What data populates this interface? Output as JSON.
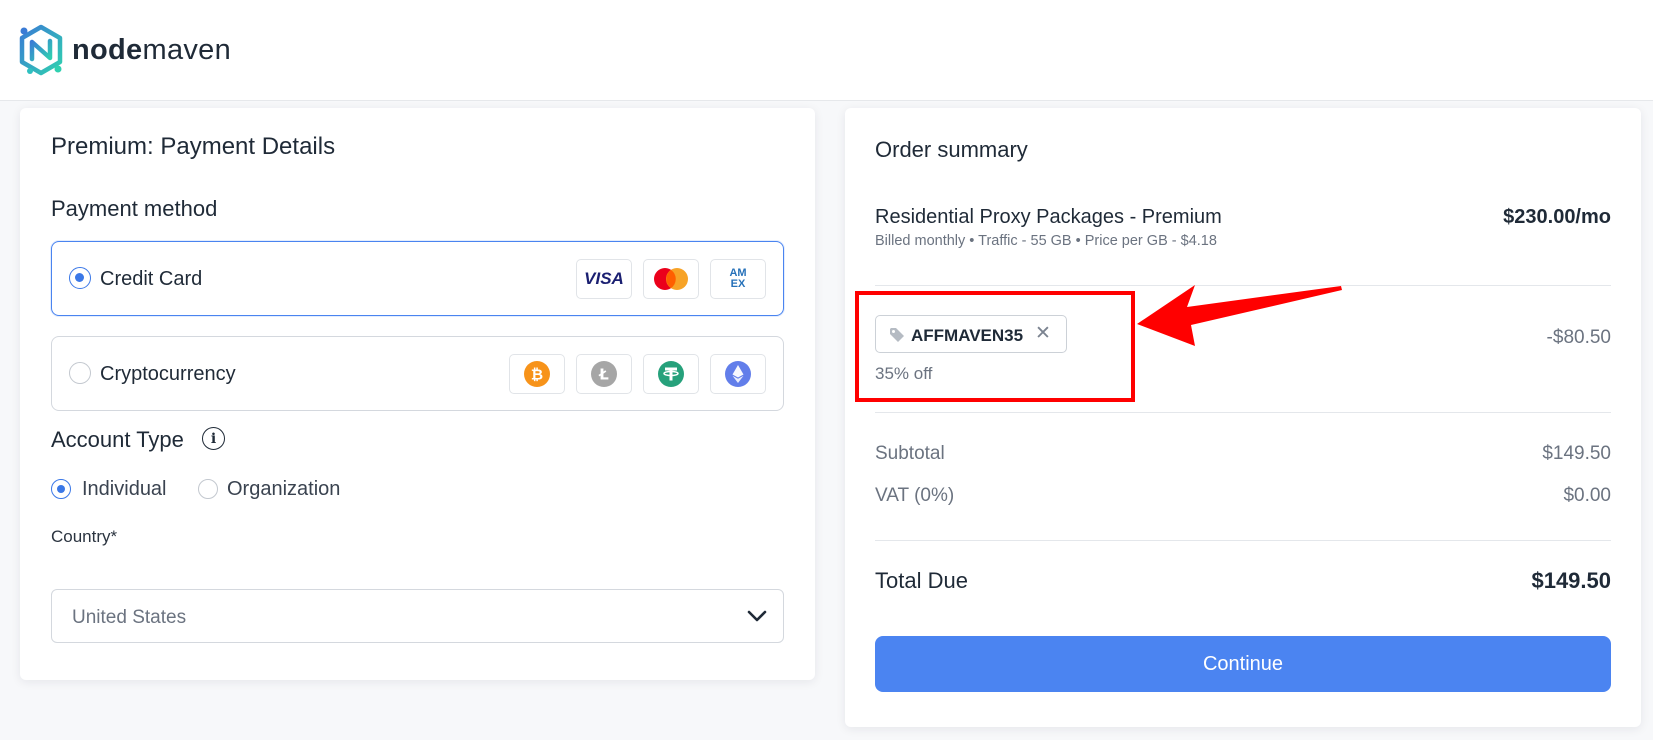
{
  "brand": {
    "name_bold": "node",
    "name_light": "maven"
  },
  "payment": {
    "title": "Premium: Payment Details",
    "method_heading": "Payment method",
    "options": [
      {
        "label": "Credit Card",
        "selected": true,
        "brands": [
          "visa-icon",
          "mastercard-icon",
          "amex-icon"
        ]
      },
      {
        "label": "Cryptocurrency",
        "selected": false,
        "brands": [
          "bitcoin-icon",
          "litecoin-icon",
          "tether-icon",
          "ethereum-icon"
        ]
      }
    ],
    "visa_text": "VISA",
    "amex_text": "AM EX",
    "account_heading": "Account Type",
    "info_glyph": "i",
    "account_options": [
      {
        "label": "Individual",
        "selected": true
      },
      {
        "label": "Organization",
        "selected": false
      }
    ],
    "country_label": "Country*",
    "country_value": "United States"
  },
  "summary": {
    "title": "Order summary",
    "item_title": "Residential Proxy Packages - Premium",
    "item_price": "$230.00/mo",
    "item_details": "Billed monthly • Traffic - 55 GB • Price per GB - $4.18",
    "coupon_code": "AFFMAVEN35",
    "coupon_remove": "✕",
    "coupon_discount_text": "35% off",
    "discount_amount": "-$80.50",
    "subtotal_label": "Subtotal",
    "subtotal_value": "$149.50",
    "vat_label": "VAT (0%)",
    "vat_value": "$0.00",
    "total_label": "Total Due",
    "total_value": "$149.50",
    "continue_label": "Continue"
  },
  "colors": {
    "accent": "#4b84f1",
    "highlight": "#ff0000",
    "bitcoin": "#f7931a",
    "litecoin": "#a6a6a6",
    "tether": "#26a17b",
    "ethereum": "#627eea"
  }
}
